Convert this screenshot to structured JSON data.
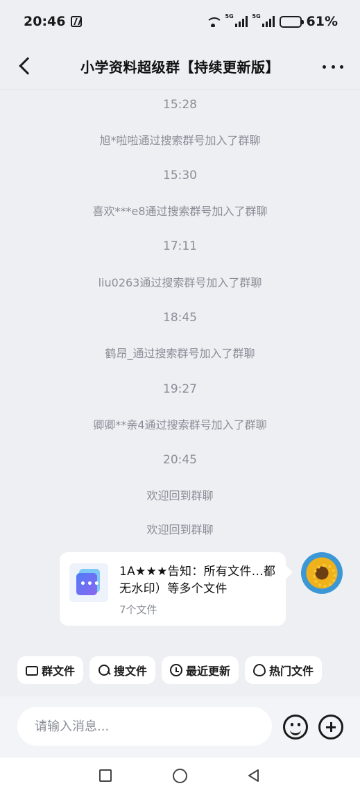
{
  "status_bar": {
    "time": "20:46",
    "battery": "61%",
    "battery_level": 0.61,
    "network_1": "5G",
    "network_2": "5G"
  },
  "header": {
    "title": "小学资料超级群【持续更新版】"
  },
  "messages": [
    {
      "type": "time",
      "text": "15:28"
    },
    {
      "type": "system",
      "text": "旭*啦啦通过搜索群号加入了群聊"
    },
    {
      "type": "time",
      "text": "15:30"
    },
    {
      "type": "system",
      "text": "喜欢***e8通过搜索群号加入了群聊"
    },
    {
      "type": "time",
      "text": "17:11"
    },
    {
      "type": "system",
      "text": "liu0263通过搜索群号加入了群聊"
    },
    {
      "type": "time",
      "text": "18:45"
    },
    {
      "type": "system",
      "text": "鹤昂_通过搜索群号加入了群聊"
    },
    {
      "type": "time",
      "text": "19:27"
    },
    {
      "type": "system",
      "text": "卿卿**亲4通过搜索群号加入了群聊"
    },
    {
      "type": "time",
      "text": "20:45"
    },
    {
      "type": "system",
      "text": "欢迎回到群聊"
    },
    {
      "type": "system",
      "text": "欢迎回到群聊"
    }
  ],
  "file_message": {
    "title": "1A★★★告知：所有文件...都无水印）等多个文件",
    "count": "7个文件"
  },
  "quick_actions": [
    {
      "label": "群文件",
      "icon": "folder-user-icon"
    },
    {
      "label": "搜文件",
      "icon": "search-icon"
    },
    {
      "label": "最近更新",
      "icon": "clock-icon"
    },
    {
      "label": "热门文件",
      "icon": "fire-icon"
    }
  ],
  "input": {
    "placeholder": "请输入消息..."
  }
}
